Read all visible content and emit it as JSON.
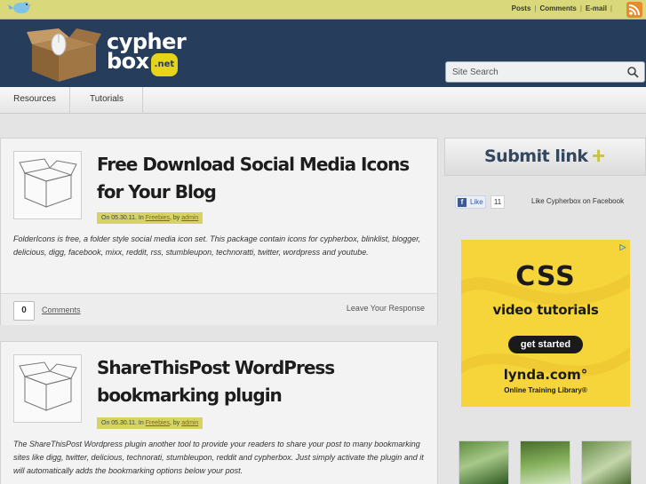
{
  "topbar": {
    "links": [
      "Posts",
      "Comments",
      "E-mail"
    ]
  },
  "header": {
    "logo_line1": "cypher",
    "logo_line2": "box",
    "logo_badge": ".net"
  },
  "search": {
    "placeholder": "Site Search"
  },
  "nav": {
    "items": [
      "Resources",
      "Tutorials"
    ]
  },
  "posts": [
    {
      "title": "Free Download Social Media Icons for Your Blog",
      "date": "On 05.30.11.",
      "in_label": "In",
      "category": "Freebies",
      "by_label": ", by",
      "author": "admin",
      "excerpt": "FolderIcons is free, a folder style social media icon set. This package contain icons for cypherbox, blinklist, blogger, delicious, digg, facebook, mixx, reddit, rss, stumbleupon, technoratti, twitter, wordpress and youtube.",
      "comment_count": "0",
      "comments_label": "Comments",
      "leave_label": "Leave Your Response"
    },
    {
      "title": "ShareThisPost WordPress bookmarking plugin",
      "date": "On 05.30.11.",
      "in_label": "In",
      "category": "Freebies",
      "by_label": ", by",
      "author": "admin",
      "excerpt": "The ShareThisPost Wordpress plugin another tool to provide your readers to share your post to many bookmarking sites like digg, twitter, delicious, technorati, stumbleupon, reddit and cypherbox. Just simply activate the plugin and it will automatically adds the bookmarking options below your post."
    }
  ],
  "sidebar": {
    "submit_label": "Submit link",
    "submit_plus": "+",
    "fb_like": "Like",
    "fb_count": "11",
    "fb_text": "Like Cypherbox on Facebook",
    "ad": {
      "title": "CSS",
      "subtitle": "video tutorials",
      "cta": "get started",
      "brand": "lynda.com°",
      "tagline": "Online Training Library®",
      "choices_icon": "▷"
    }
  },
  "colors": {
    "topbar": "#d9d87a",
    "header": "#263e5c",
    "ad": "#f6d53a",
    "meta": "#d4d364"
  }
}
